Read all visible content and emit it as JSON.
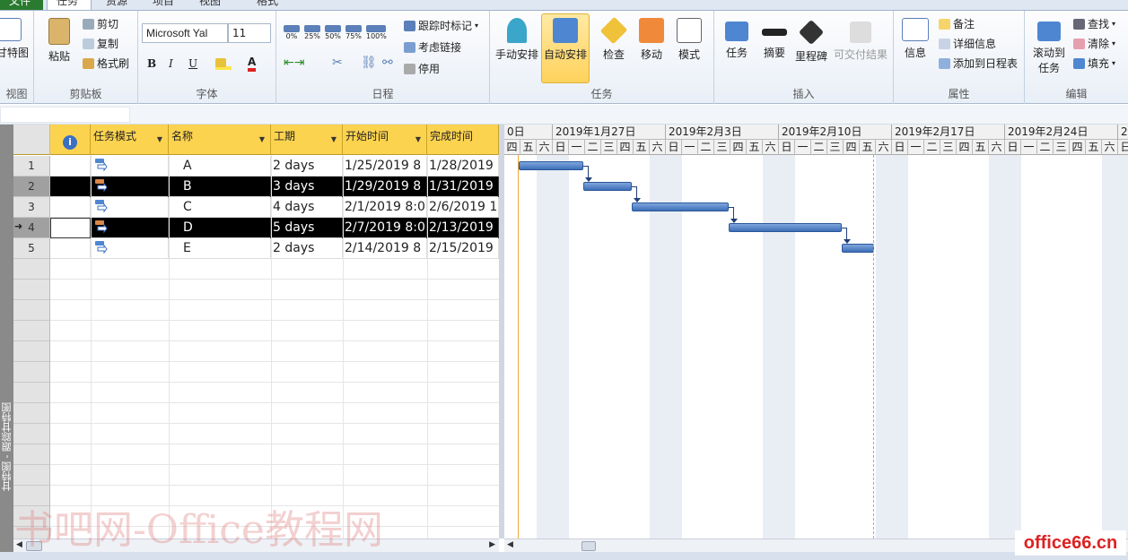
{
  "tabs": [
    "文件",
    "任务",
    "资源",
    "项目",
    "视图",
    "格式"
  ],
  "ribbon": {
    "view": {
      "gantt_label": "甘特图",
      "group": "视图"
    },
    "clipboard": {
      "paste": "粘贴",
      "cut": "剪切",
      "copy": "复制",
      "format_painter": "格式刷",
      "group": "剪贴板"
    },
    "font": {
      "name": "Microsoft Yal",
      "size": "11",
      "bold": "B",
      "italic": "I",
      "underline": "U",
      "color_letter": "A",
      "group": "字体"
    },
    "schedule": {
      "pcts": [
        "0%",
        "25%",
        "50%",
        "75%",
        "100%"
      ],
      "track": "跟踪时标记",
      "respect_links": "考虑链接",
      "inactivate": "停用",
      "group": "日程"
    },
    "tasks": {
      "manual": "手动安排",
      "auto": "自动安排",
      "inspect": "检查",
      "move": "移动",
      "mode": "模式",
      "group": "任务"
    },
    "insert": {
      "task": "任务",
      "summary": "摘要",
      "milestone": "里程碑",
      "deliverable": "可交付结果",
      "group": "插入"
    },
    "properties": {
      "info": "信息",
      "notes": "备注",
      "details": "详细信息",
      "add_timeline": "添加到日程表",
      "group": "属性"
    },
    "editing": {
      "scroll_to": "滚动到",
      "scroll_to2": "任务",
      "find": "查找",
      "clear": "清除",
      "fill": "填充",
      "group": "编辑"
    }
  },
  "side_label": "甘特图 - 跟踪甘特图",
  "grid": {
    "headers": [
      "任务模式",
      "名称",
      "工期",
      "开始时间",
      "完成时间"
    ],
    "rows": [
      {
        "num": "1",
        "name": "A",
        "duration": "2 days",
        "start": "1/25/2019 8",
        "finish": "1/28/2019",
        "selected": false,
        "arrow": ""
      },
      {
        "num": "2",
        "name": "B",
        "duration": "3 days",
        "start": "1/29/2019 8",
        "finish": "1/31/2019",
        "selected": true,
        "arrow": ""
      },
      {
        "num": "3",
        "name": "C",
        "duration": "4 days",
        "start": "2/1/2019 8:0",
        "finish": "2/6/2019 1",
        "selected": false,
        "arrow": ""
      },
      {
        "num": "4",
        "name": "D",
        "duration": "5 days",
        "start": "2/7/2019 8:0",
        "finish": "2/13/2019",
        "selected": true,
        "arrow": "➜"
      },
      {
        "num": "5",
        "name": "E",
        "duration": "2 days",
        "start": "2/14/2019 8",
        "finish": "2/15/2019",
        "selected": false,
        "arrow": ""
      }
    ]
  },
  "gantt": {
    "weeks": [
      "0日",
      "2019年1月27日",
      "2019年2月3日",
      "2019年2月10日",
      "2019年2月17日",
      "2019年2月24日",
      "2"
    ],
    "days": [
      "四",
      "五",
      "六",
      "日",
      "一",
      "二",
      "三",
      "四",
      "五",
      "六",
      "日",
      "一",
      "二",
      "三",
      "四",
      "五",
      "六",
      "日",
      "一",
      "二",
      "三",
      "四",
      "五",
      "六",
      "日",
      "一",
      "二",
      "三",
      "四",
      "五",
      "六",
      "日",
      "一",
      "二",
      "三",
      "四",
      "五",
      "六",
      "日"
    ]
  },
  "watermark": "书吧网-Office教程网",
  "logo": "office66.cn",
  "colors": {
    "header": "#fcd34f",
    "bar": "#3d6fb8",
    "selected": "#000000",
    "file_tab": "#2a7a2f"
  }
}
